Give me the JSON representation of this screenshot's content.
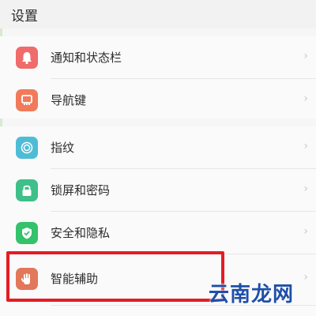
{
  "header": {
    "title": "设置"
  },
  "items": [
    {
      "label": "通知和状态栏",
      "icon": "bell-icon",
      "color": "#f06b6b"
    },
    {
      "label": "导航键",
      "icon": "navigation-icon",
      "color": "#f07a5a"
    },
    {
      "label": "指纹",
      "icon": "fingerprint-icon",
      "color": "#4fbcd6"
    },
    {
      "label": "锁屏和密码",
      "icon": "lock-icon",
      "color": "#3fbf8a"
    },
    {
      "label": "安全和隐私",
      "icon": "shield-icon",
      "color": "#34c26b"
    },
    {
      "label": "智能辅助",
      "icon": "hand-icon",
      "color": "#e2775a"
    }
  ],
  "chevron": "›",
  "watermark": "云南龙网",
  "colors": {
    "highlight": "#e51c23",
    "watermark": "#1f4fa8"
  }
}
